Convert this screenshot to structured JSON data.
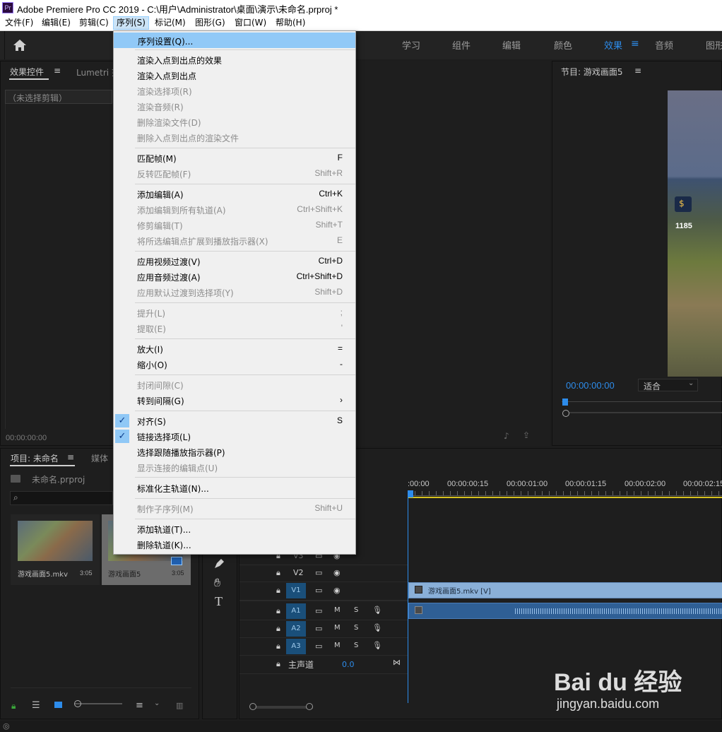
{
  "app": {
    "title": "Adobe Premiere Pro CC 2019 - C:\\用户\\Administrator\\桌面\\演示\\未命名.prproj *",
    "logo_text": "Pr"
  },
  "menubar": [
    "文件(F)",
    "编辑(E)",
    "剪辑(C)",
    "序列(S)",
    "标记(M)",
    "图形(G)",
    "窗口(W)",
    "帮助(H)"
  ],
  "workspaces": [
    "学习",
    "组件",
    "编辑",
    "颜色",
    "效果",
    "音频",
    "图形"
  ],
  "active_workspace": "效果",
  "effect_controls": {
    "tab": "效果控件",
    "tab2": "Lumetri 范",
    "empty": "（未选择剪辑）",
    "timecode": "00:00:00:00"
  },
  "program_monitor": {
    "title": "节目: 游戏画面5",
    "timecode": "00:00:00:00",
    "fit": "适合",
    "gold": "1185"
  },
  "sequence_menu": {
    "items": [
      {
        "label": "序列设置(Q)...",
        "shortcut": "",
        "disabled": false,
        "highlight": true,
        "checked": false
      },
      {
        "label": "渲染入点到出点的效果",
        "shortcut": "",
        "disabled": false,
        "checked": false
      },
      {
        "label": "渲染入点到出点",
        "shortcut": "",
        "disabled": false,
        "checked": false
      },
      {
        "label": "渲染选择项(R)",
        "shortcut": "",
        "disabled": true,
        "checked": false
      },
      {
        "label": "渲染音频(R)",
        "shortcut": "",
        "disabled": true,
        "checked": false
      },
      {
        "label": "删除渲染文件(D)",
        "shortcut": "",
        "disabled": true,
        "checked": false
      },
      {
        "label": "删除入点到出点的渲染文件",
        "shortcut": "",
        "disabled": true,
        "checked": false
      },
      {
        "label": "匹配帧(M)",
        "shortcut": "F",
        "disabled": false,
        "checked": false
      },
      {
        "label": "反转匹配帧(F)",
        "shortcut": "Shift+R",
        "disabled": true,
        "checked": false
      },
      {
        "label": "添加编辑(A)",
        "shortcut": "Ctrl+K",
        "disabled": false,
        "checked": false
      },
      {
        "label": "添加编辑到所有轨道(A)",
        "shortcut": "Ctrl+Shift+K",
        "disabled": true,
        "checked": false
      },
      {
        "label": "修剪编辑(T)",
        "shortcut": "Shift+T",
        "disabled": true,
        "checked": false
      },
      {
        "label": "将所选编辑点扩展到播放指示器(X)",
        "shortcut": "E",
        "disabled": true,
        "checked": false
      },
      {
        "label": "应用视频过渡(V)",
        "shortcut": "Ctrl+D",
        "disabled": false,
        "checked": false
      },
      {
        "label": "应用音频过渡(A)",
        "shortcut": "Ctrl+Shift+D",
        "disabled": false,
        "checked": false
      },
      {
        "label": "应用默认过渡到选择项(Y)",
        "shortcut": "Shift+D",
        "disabled": true,
        "checked": false
      },
      {
        "label": "提升(L)",
        "shortcut": ";",
        "disabled": true,
        "checked": false
      },
      {
        "label": "提取(E)",
        "shortcut": "'",
        "disabled": true,
        "checked": false
      },
      {
        "label": "放大(I)",
        "shortcut": "=",
        "disabled": false,
        "checked": false
      },
      {
        "label": "缩小(O)",
        "shortcut": "-",
        "disabled": false,
        "checked": false
      },
      {
        "label": "封闭间隙(C)",
        "shortcut": "",
        "disabled": true,
        "checked": false
      },
      {
        "label": "转到间隔(G)",
        "shortcut": "›",
        "disabled": false,
        "checked": false
      },
      {
        "label": "对齐(S)",
        "shortcut": "S",
        "disabled": false,
        "checked": true
      },
      {
        "label": "链接选择项(L)",
        "shortcut": "",
        "disabled": false,
        "checked": true
      },
      {
        "label": "选择跟随播放指示器(P)",
        "shortcut": "",
        "disabled": false,
        "checked": false
      },
      {
        "label": "显示连接的编辑点(U)",
        "shortcut": "",
        "disabled": true,
        "checked": false
      },
      {
        "label": "标准化主轨道(N)...",
        "shortcut": "",
        "disabled": false,
        "checked": false
      },
      {
        "label": "制作子序列(M)",
        "shortcut": "Shift+U",
        "disabled": true,
        "checked": false
      },
      {
        "label": "添加轨道(T)...",
        "shortcut": "",
        "disabled": false,
        "checked": false
      },
      {
        "label": "删除轨道(K)...",
        "shortcut": "",
        "disabled": false,
        "checked": false
      }
    ]
  },
  "project": {
    "tab": "项目: 未命名",
    "tab2": "媒体",
    "file": "未命名.prproj",
    "clips": [
      {
        "name": "游戏画面5.mkv",
        "duration": "3:05"
      },
      {
        "name": "游戏画面5",
        "duration": "3:05"
      }
    ]
  },
  "timeline": {
    "ruler": [
      ":00:00",
      "00:00:00:15",
      "00:00:01:00",
      "00:00:01:15",
      "00:00:02:00",
      "00:00:02:15"
    ],
    "video_tracks": [
      "V3",
      "V2",
      "V1"
    ],
    "audio_tracks": [
      "A1",
      "A2",
      "A3"
    ],
    "mute": "M",
    "solo": "S",
    "master_label": "主声道",
    "master_value": "0.0",
    "clip_v1": "游戏画面5.mkv [V]"
  },
  "watermark": {
    "brand": "Bai du 经验",
    "url": "jingyan.baidu.com"
  }
}
